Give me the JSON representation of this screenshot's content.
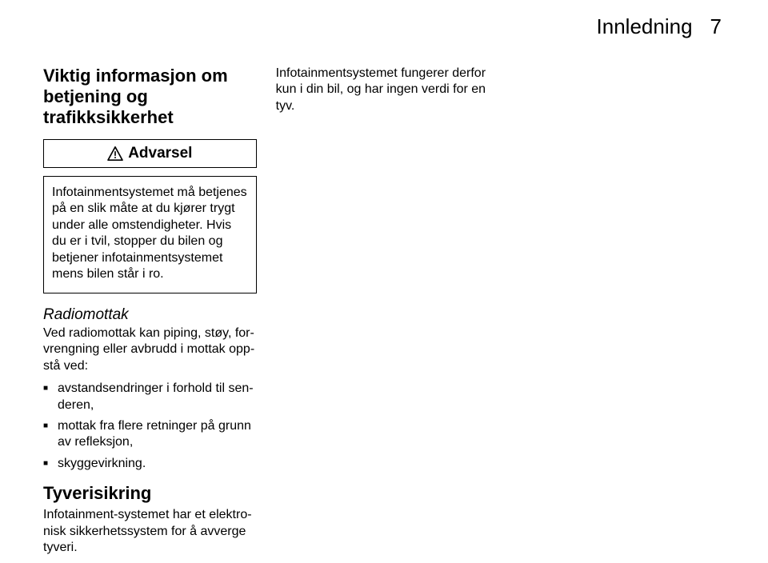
{
  "header": {
    "title": "Innledning",
    "page_number": "7"
  },
  "col1": {
    "heading": "Viktig informasjon om betjening og trafikksikkerhet",
    "warning_label": "Advarsel",
    "warning_body_1": "Infotainmentsystemet må betje­nes på en slik måte at du kjører trygt under alle omstendigheter. Hvis du er i tvil, stopper du bilen og betjener infotainmentsystemet mens bilen står i ro.",
    "sub_heading": "Radiomottak",
    "sub_body": "Ved radiomottak kan piping, støy, for­vrengning eller avbrudd i mottak opp­stå ved:",
    "bullets": [
      "avstandsendringer i forhold til sen­deren,",
      "mottak fra flere retninger på grunn av refleksjon,",
      "skyggevirkning."
    ],
    "heading2": "Tyverisikring",
    "body2": "Infotainment-systemet har et elektro­nisk sikkerhetssystem for å avverge tyveri."
  },
  "col2": {
    "body": "Infotainmentsystemet fungerer derfor kun i din bil, og har ingen verdi for en tyv."
  }
}
